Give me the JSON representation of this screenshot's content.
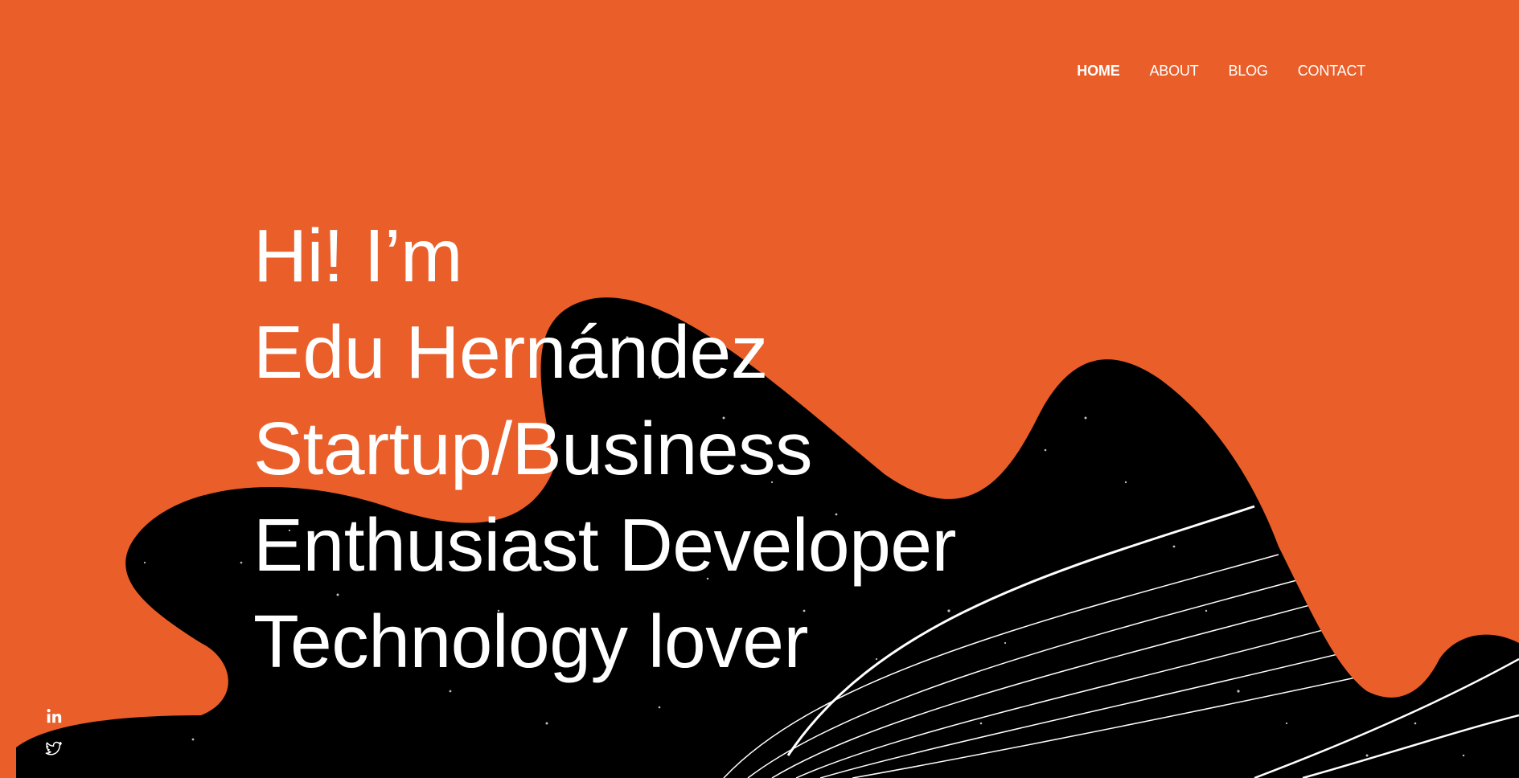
{
  "nav": {
    "items": [
      {
        "label": "HOME",
        "active": true
      },
      {
        "label": "ABOUT",
        "active": false
      },
      {
        "label": "BLOG",
        "active": false
      },
      {
        "label": "CONTACT",
        "active": false
      }
    ]
  },
  "hero": {
    "lines": [
      "Hi! I’m",
      "Edu Hernández",
      "Startup/Business",
      "Enthusiast Developer",
      "Technology lover"
    ]
  },
  "social": {
    "icons": [
      "linkedin-icon",
      "twitter-icon"
    ]
  },
  "colors": {
    "background": "#EA5E2A",
    "blob": "#000000",
    "text": "#FFFFFF"
  }
}
